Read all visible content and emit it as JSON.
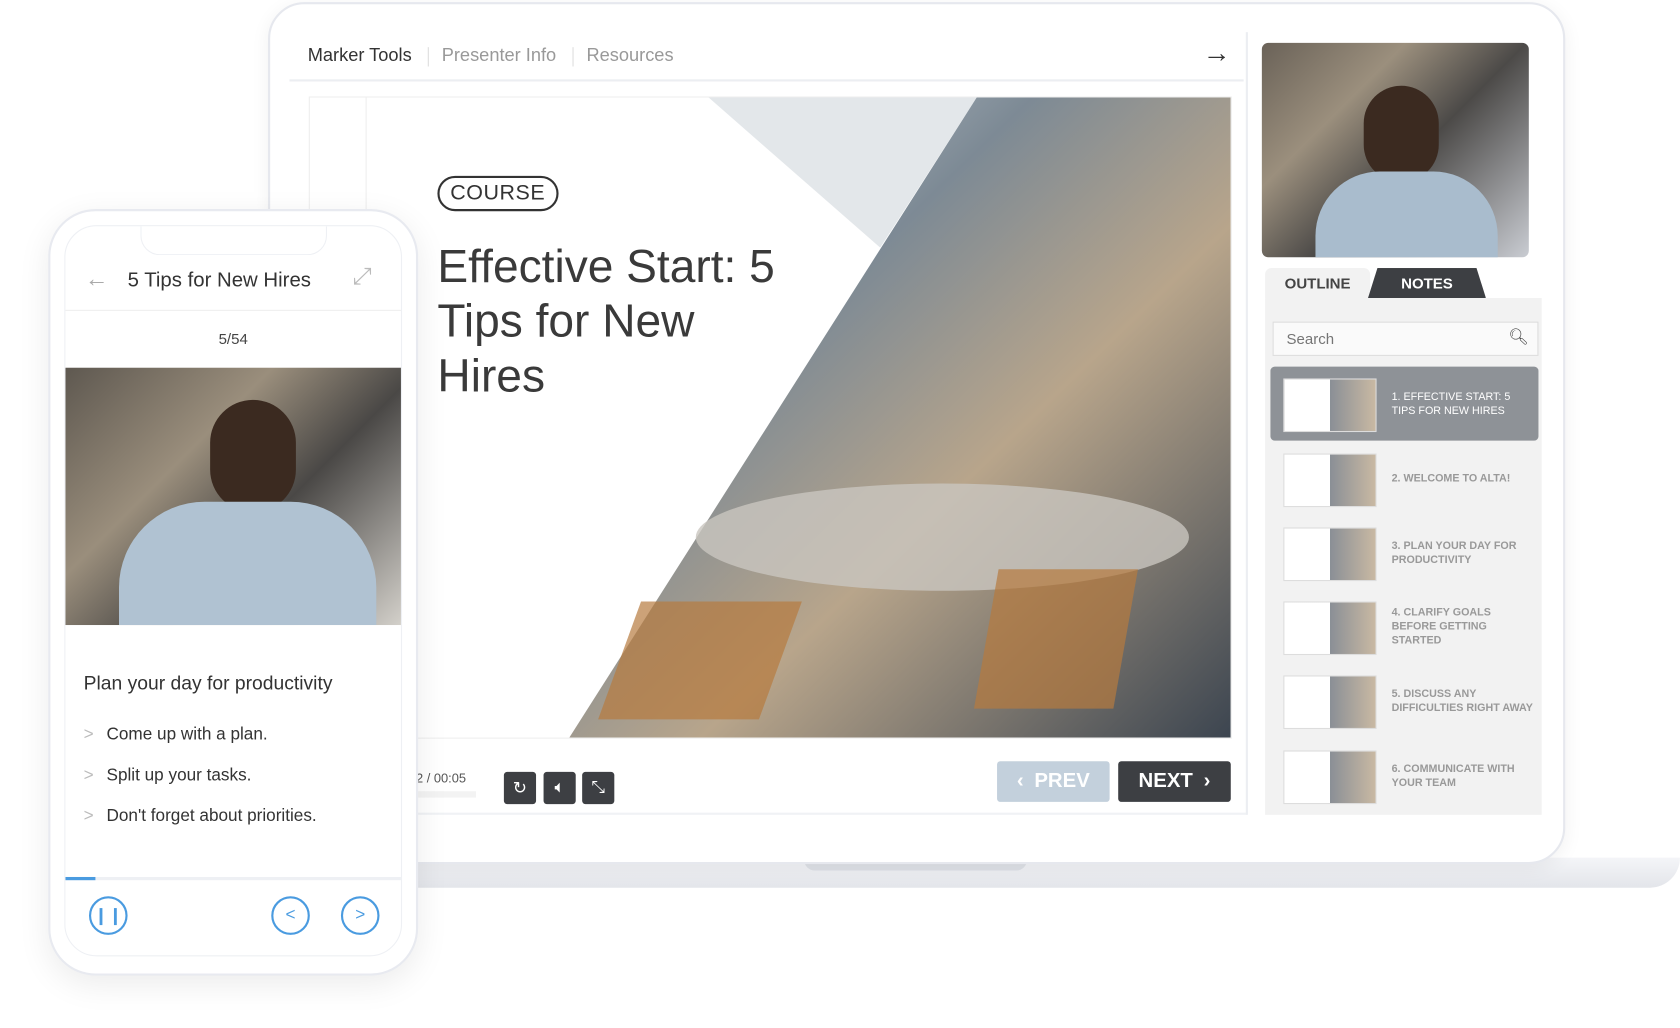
{
  "laptop": {
    "tabs": [
      "Marker Tools",
      "Presenter Info",
      "Resources"
    ],
    "slide": {
      "badge": "COURSE",
      "title": "Effective Start: 5 Tips for New Hires"
    },
    "player": {
      "time": "2 / 00:05",
      "prev": "PREV",
      "next": "NEXT"
    },
    "sidebar": {
      "tabs": [
        "OUTLINE",
        "NOTES"
      ],
      "active_tab": "NOTES",
      "search_placeholder": "Search",
      "items": [
        {
          "label": "1. EFFECTIVE START: 5 TIPS FOR NEW HIRES",
          "selected": true
        },
        {
          "label": "2. WELCOME TO ALTA!"
        },
        {
          "label": "3. PLAN YOUR DAY FOR PRODUCTIVITY"
        },
        {
          "label": "4. CLARIFY GOALS BEFORE GETTING STARTED"
        },
        {
          "label": "5. DISCUSS ANY DIFFICULTIES RIGHT AWAY"
        },
        {
          "label": "6. COMMUNICATE WITH YOUR TEAM"
        }
      ]
    }
  },
  "phone": {
    "title": "5 Tips for New Hires",
    "counter": "5/54",
    "heading": "Plan your day for productivity",
    "bullets": [
      "Come up with a plan.",
      "Split up your tasks.",
      "Don't forget about priorities."
    ],
    "progress_percent": 9,
    "accent": "#4a9be0"
  }
}
